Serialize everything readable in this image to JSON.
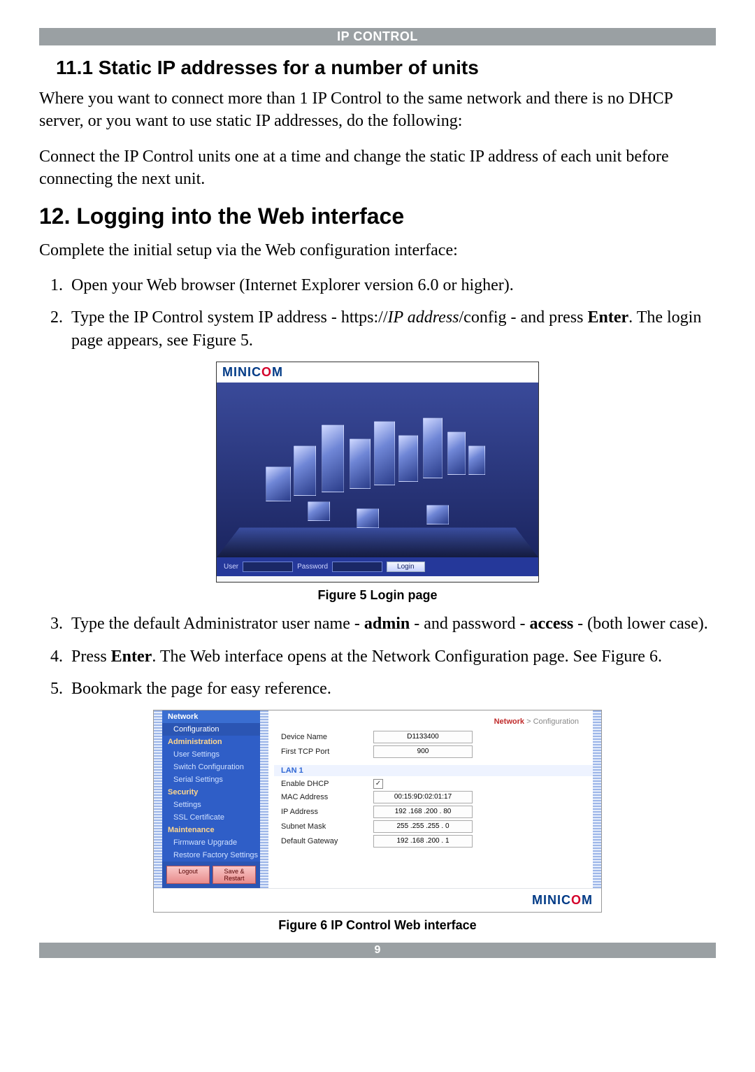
{
  "header": {
    "title": "IP CONTROL"
  },
  "sec11_1": {
    "heading": "11.1 Static IP addresses for a number of units",
    "p1": "Where you want to connect more than 1 IP Control to the same network and there is no DHCP server, or you want to use static IP addresses, do the following:",
    "p2": "Connect the IP Control units one at a time and change the static IP address of each unit before connecting the next unit."
  },
  "sec12": {
    "heading": "12. Logging into the Web interface",
    "intro": "Complete the initial setup via the Web configuration interface:",
    "step1": "Open your Web browser (Internet Explorer version 6.0 or higher).",
    "step2_a": "Type the IP Control system IP address - https://",
    "step2_b": "IP address",
    "step2_c": "/config - and press ",
    "step2_d": "Enter",
    "step2_e": ". The login page appears, see Figure 5.",
    "step3_a": "Type the default Administrator user name - ",
    "step3_b": "admin",
    "step3_c": " - and password - ",
    "step3_d": "access",
    "step3_e": " - (both lower case).",
    "step4_a": "Press ",
    "step4_b": "Enter",
    "step4_c": ". The Web interface opens at the Network Configuration page. See Figure 6.",
    "step5": "Bookmark the page for easy reference."
  },
  "fig5": {
    "logo_a": "MINIC",
    "logo_b": "O",
    "logo_c": "M",
    "user_label": "User",
    "password_label": "Password",
    "login_label": "Login",
    "caption": "Figure 5 Login page"
  },
  "fig6": {
    "crumb_a": "Network",
    "crumb_sep": " > ",
    "crumb_b": "Configuration",
    "side": {
      "network": "Network",
      "items_net": [
        "Configuration"
      ],
      "administration": "Administration",
      "items_admin": [
        "User Settings",
        "Switch Configuration",
        "Serial Settings"
      ],
      "security": "Security",
      "items_sec": [
        "Settings",
        "SSL Certificate"
      ],
      "maintenance": "Maintenance",
      "items_maint": [
        "Firmware Upgrade",
        "Restore Factory Settings"
      ],
      "btn_logout": "Logout",
      "btn_save": "Save & Restart"
    },
    "form": {
      "device_name_lbl": "Device Name",
      "device_name_val": "D1133400",
      "tcp_port_lbl": "First TCP Port",
      "tcp_port_val": "900",
      "lan1": "LAN 1",
      "enable_dhcp_lbl": "Enable DHCP",
      "enable_dhcp_checked": "✓",
      "mac_lbl": "MAC Address",
      "mac_val": "00:15:9D:02:01:17",
      "ip_lbl": "IP Address",
      "ip_val": "192 .168 .200 . 80",
      "mask_lbl": "Subnet Mask",
      "mask_val": "255 .255 .255 .  0",
      "gw_lbl": "Default Gateway",
      "gw_val": "192 .168 .200 .  1"
    },
    "footer_a": "MINIC",
    "footer_b": "O",
    "footer_c": "M",
    "caption": "Figure 6 IP Control Web interface"
  },
  "footer": {
    "pagenum": "9"
  }
}
